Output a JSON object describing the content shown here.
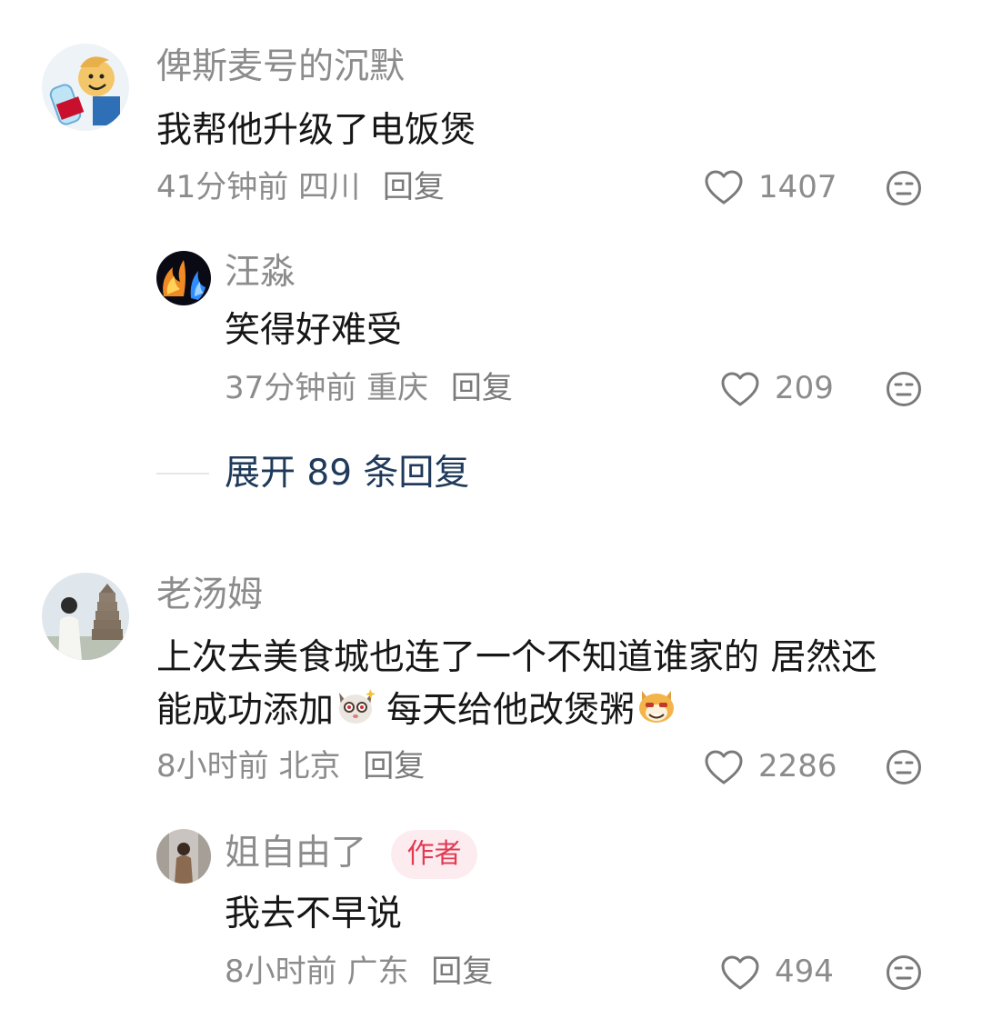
{
  "comments": [
    {
      "user": "俾斯麦号的沉默",
      "text": "我帮他升级了电饭煲",
      "time": "41分钟前",
      "location": "四川",
      "reply_label": "回复",
      "likes": "1407",
      "replies": [
        {
          "user": "汪淼",
          "text": "笑得好难受",
          "time": "37分钟前",
          "location": "重庆",
          "reply_label": "回复",
          "likes": "209"
        }
      ],
      "expand_label": "展开 89 条回复"
    },
    {
      "user": "老汤姆",
      "text_line1": "上次去美食城也连了一个不知道谁家的 居然还",
      "text_line2_a": "能成功添加",
      "text_line2_b": "每天给他改煲粥",
      "time": "8小时前",
      "location": "北京",
      "reply_label": "回复",
      "likes": "2286",
      "replies": [
        {
          "user": "姐自由了",
          "badge": "作者",
          "text": "我去不早说",
          "time": "8小时前",
          "location": "广东",
          "reply_label": "回复",
          "likes": "494"
        }
      ]
    }
  ],
  "icons": {
    "like": "heart-outline-icon",
    "dislike": "neutral-face-icon",
    "emoji1": "cat-shocked-emoji",
    "emoji2": "dog-grin-emoji"
  },
  "colors": {
    "name": "#8c8c8c",
    "text": "#161616",
    "expand": "#1f3a5a",
    "badge_text": "#e23a53",
    "badge_bg": "#fdecef"
  }
}
